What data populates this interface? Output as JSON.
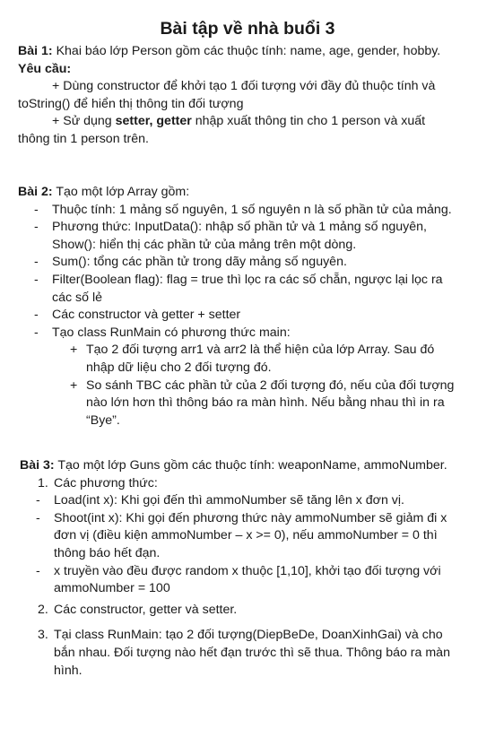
{
  "title": "Bài tập về nhà buổi 3",
  "bai1": {
    "label": "Bài 1:",
    "intro": " Khai báo lớp Person gồm các thuộc tính: name, age, gender, hobby.",
    "yeucau": "Yêu cầu:",
    "req1": "+ Dùng constructor để khởi tạo 1 đối tượng với đầy đủ thuộc tính và toString() để hiển thị thông tin đối tượng",
    "req2_pre": "+ Sử dụng ",
    "req2_bold": "setter, getter",
    "req2_post": " nhập xuất thông tin cho 1 person và xuất thông tin 1 person trên."
  },
  "bai2": {
    "label": "Bài 2:",
    "intro": " Tạo một lớp Array gồm:",
    "items": [
      "Thuộc tính: 1 mảng số nguyên, 1 số nguyên n là số phần tử của mảng.",
      "Phương thức: InputData(): nhập số phần tử và 1 mảng số nguyên, Show(): hiển thị các phần tử của mảng trên một dòng.",
      "Sum(): tổng các phần tử trong dãy mảng số nguyên.",
      "Filter(Boolean flag): flag = true thì lọc ra các số chẵn, ngược lại lọc ra các số lẻ",
      "Các constructor và getter + setter",
      "Tạo class RunMain có phương thức main:"
    ],
    "subitems": [
      "Tạo 2 đối tượng arr1 và arr2 là thể hiện của lớp Array. Sau đó nhập dữ liệu cho 2 đối tượng đó.",
      "So sánh TBC các phần tử của 2 đối tượng đó, nếu của đối tượng nào lớn hơn thì thông báo ra màn hình. Nếu bằng nhau thì in ra “Bye”."
    ]
  },
  "bai3": {
    "label": "Bài 3:",
    "intro": " Tạo một lớp Guns gồm các thuộc tính: weaponName, ammoNumber.",
    "n1": "Các phương thức:",
    "dash": [
      "Load(int x): Khi gọi đến thì ammoNumber sẽ tăng lên x đơn vị.",
      "Shoot(int x): Khi gọi đến phương thức này ammoNumber sẽ giảm đi x đơn vị (điều kiện ammoNumber – x >= 0), nếu ammoNumber = 0 thì thông báo hết đạn.",
      "x truyền vào đều được random x thuộc [1,10], khởi tạo đối tượng với ammoNumber = 100"
    ],
    "n2": "Các constructor, getter và setter.",
    "n3": "Tại class RunMain: tạo 2 đối tượng(DiepBeDe, DoanXinhGai) và cho bắn nhau. Đối tượng nào hết đạn trước thì sẽ thua. Thông báo ra màn hình."
  },
  "markers": {
    "dash": "-",
    "plus": "+",
    "one": "1.",
    "two": "2.",
    "three": "3."
  }
}
